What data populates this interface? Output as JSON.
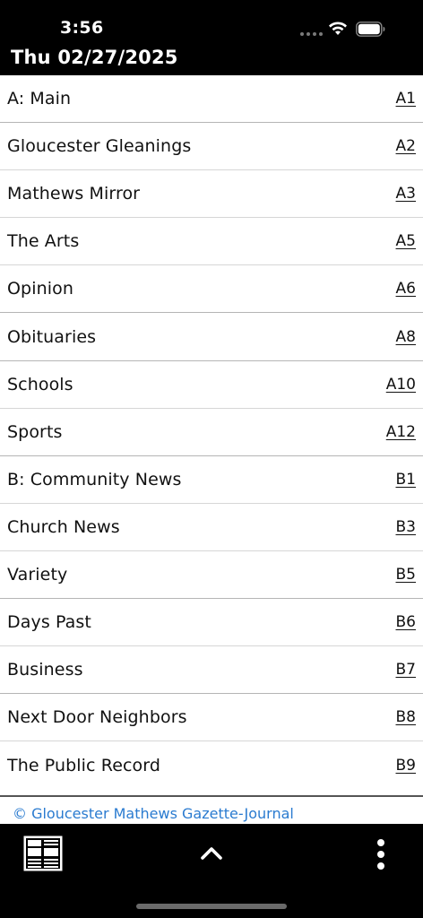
{
  "status_bar": {
    "time": "3:56"
  },
  "header": {
    "date": "Thu 02/27/2025"
  },
  "sections": [
    {
      "name": "A: Main",
      "page": "A1"
    },
    {
      "name": "Gloucester Gleanings",
      "page": "A2"
    },
    {
      "name": "Mathews Mirror",
      "page": "A3"
    },
    {
      "name": "The Arts",
      "page": "A5"
    },
    {
      "name": "Opinion",
      "page": "A6"
    },
    {
      "name": "Obituaries",
      "page": "A8"
    },
    {
      "name": "Schools",
      "page": "A10"
    },
    {
      "name": "Sports",
      "page": "A12"
    },
    {
      "name": "B: Community News",
      "page": "B1"
    },
    {
      "name": "Church News",
      "page": "B3"
    },
    {
      "name": "Variety",
      "page": "B5"
    },
    {
      "name": "Days Past",
      "page": "B6"
    },
    {
      "name": "Business",
      "page": "B7"
    },
    {
      "name": "Next Door Neighbors",
      "page": "B8"
    },
    {
      "name": "The Public Record",
      "page": "B9"
    }
  ],
  "footer": {
    "copyright": "© Gloucester Mathews Gazette-Journal"
  },
  "toolbar": {
    "left_icon": "newspaper-icon",
    "center_icon": "chevron-up-icon",
    "right_icon": "more-vertical-icon"
  },
  "colors": {
    "link": "#2a7bd0",
    "background": "#000000",
    "list_background": "#ffffff"
  }
}
